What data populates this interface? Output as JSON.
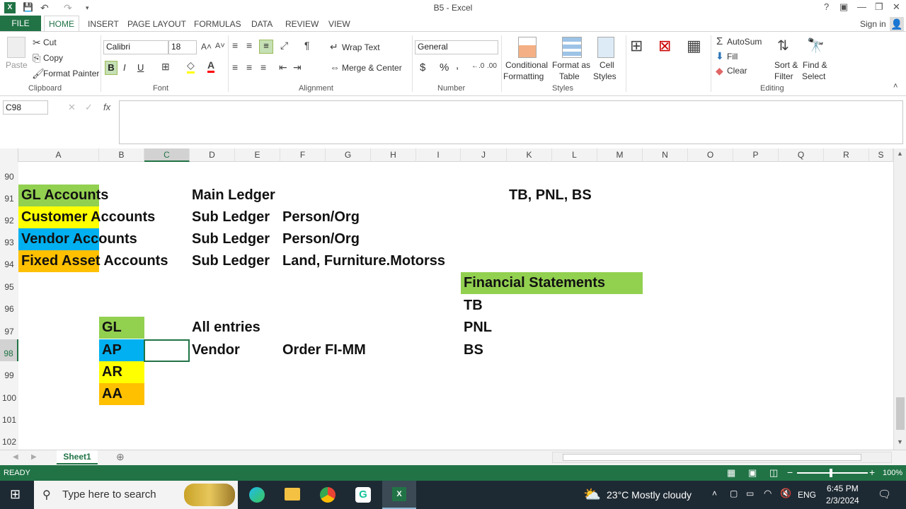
{
  "window": {
    "title": "B5 - Excel",
    "help": "?",
    "minimize": "—",
    "restore": "❐",
    "close": "✕"
  },
  "ribbon_tabs": [
    "FILE",
    "HOME",
    "INSERT",
    "PAGE LAYOUT",
    "FORMULAS",
    "DATA",
    "REVIEW",
    "VIEW"
  ],
  "signin": "Sign in",
  "clipboard": {
    "paste": "Paste",
    "cut": "Cut",
    "copy": "Copy",
    "format_painter": "Format Painter",
    "group": "Clipboard"
  },
  "font": {
    "name": "Calibri",
    "size": "18",
    "bold": "B",
    "italic": "I",
    "underline": "U",
    "group": "Font"
  },
  "alignment": {
    "wrap": "Wrap Text",
    "merge": "Merge & Center",
    "group": "Alignment"
  },
  "number": {
    "format": "General",
    "currency": "$",
    "percent": "%",
    "comma": ",",
    "group": "Number"
  },
  "styles": {
    "conditional": "Conditional",
    "formatting": "Formatting",
    "format_as": "Format as",
    "table": "Table",
    "cell": "Cell",
    "cell_styles": "Styles",
    "group": "Styles"
  },
  "cells": {
    "a91": "GL Accounts",
    "d91": "Main Ledger",
    "k91": "TB, PNL, BS",
    "a92": "Customer Accounts",
    "d92": "Sub Ledger",
    "f92": "Person/Org",
    "a93": "Vendor Accounts",
    "d93": "Sub Ledger",
    "f93": "Person/Org",
    "a94": "Fixed Asset Accounts",
    "d94": "Sub Ledger",
    "f94": "Land, Furniture.Motorss",
    "j95": "Financial Statements",
    "j96": "TB",
    "b97": "GL",
    "d97": "All entries",
    "j97": "PNL",
    "b98": "AP",
    "d98": "Vendor",
    "f98": "Order FI-MM",
    "j98": "BS",
    "b99": "AR",
    "b100": "AA"
  },
  "editing": {
    "autosum": "AutoSum",
    "fill": "Fill",
    "clear": "Clear",
    "sort": "Sort &",
    "filter": "Filter",
    "find": "Find &",
    "select": "Select",
    "group": "Editing"
  },
  "formula_bar": {
    "name_box": "C98",
    "fx": "fx",
    "value": ""
  },
  "columns": [
    "A",
    "B",
    "C",
    "D",
    "E",
    "F",
    "G",
    "H",
    "I",
    "J",
    "K",
    "L",
    "M",
    "N",
    "O",
    "P",
    "Q",
    "R",
    "S"
  ],
  "rows": [
    "90",
    "91",
    "92",
    "93",
    "94",
    "95",
    "96",
    "97",
    "98",
    "99",
    "100",
    "101",
    "102"
  ],
  "colors": {
    "green": "#92d050",
    "yellow": "#ffff00",
    "blue": "#00b0f0",
    "orange": "#ffc000",
    "excel": "#217346"
  },
  "sheet_tab": "Sheet1",
  "status": {
    "ready": "READY",
    "zoom": "100%"
  },
  "taskbar": {
    "search": "Type here to search",
    "weather": "23°C  Mostly cloudy",
    "lang": "ENG",
    "time": "6:45 PM",
    "date": "2/3/2024"
  }
}
